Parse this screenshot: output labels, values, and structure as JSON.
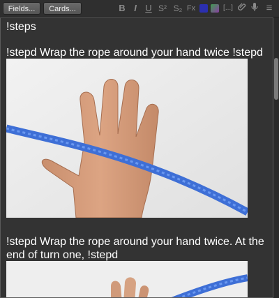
{
  "toolbar": {
    "fields_label": "Fields...",
    "cards_label": "Cards...",
    "bold": "B",
    "italic": "I",
    "underline": "U",
    "superscript": "S²",
    "subscript": "S₂",
    "clear_format": "Fx",
    "cloze": "[...]",
    "attach": "⌀",
    "record": "🎙",
    "more": "≡",
    "text_color": "#2b2fb0"
  },
  "editor": {
    "heading": "!steps",
    "step1": "!stepd Wrap the rope around your hand twice !stepd",
    "step2_line1": "!stepd Wrap the rope around your hand twice. At the",
    "step2_line2": "end of turn one, !stepd"
  }
}
